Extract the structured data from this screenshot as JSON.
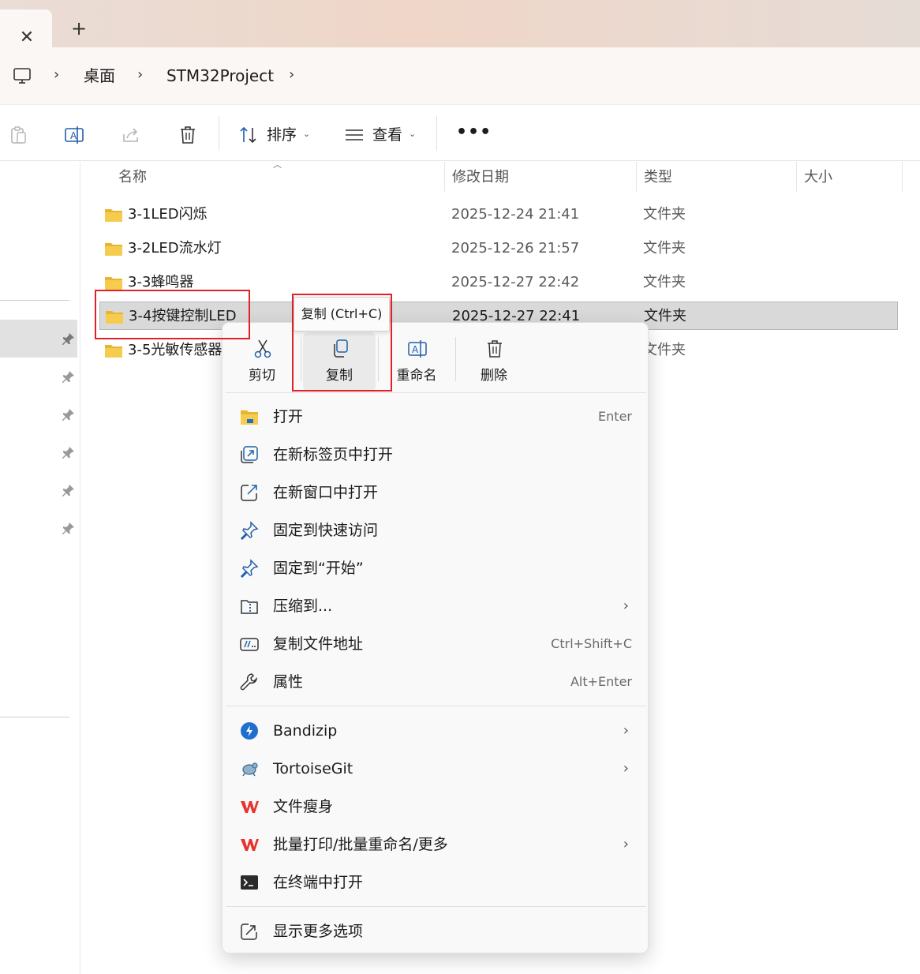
{
  "window": {
    "tab_close": "✕",
    "tab_new": "+"
  },
  "breadcrumb": {
    "items": [
      "桌面",
      "STM32Project"
    ],
    "separator": "›"
  },
  "toolbar": {
    "sort_label": "排序",
    "view_label": "查看",
    "more_label": "•••",
    "caret": "⌄"
  },
  "columns": {
    "name": "名称",
    "date": "修改日期",
    "type": "类型",
    "size": "大小"
  },
  "files": [
    {
      "name": "3-1LED闪烁",
      "date": "2025-12-24 21:41",
      "type": "文件夹"
    },
    {
      "name": "3-2LED流水灯",
      "date": "2025-12-26 21:57",
      "type": "文件夹"
    },
    {
      "name": "3-3蜂鸣器",
      "date": "2025-12-27 22:42",
      "type": "文件夹"
    },
    {
      "name": "3-4按键控制LED",
      "date": "2025-12-27 22:41",
      "type": "文件夹"
    },
    {
      "name": "3-5光敏传感器",
      "date": "",
      "type": "文件夹"
    }
  ],
  "tooltip": "复制 (Ctrl+C)",
  "context_menu": {
    "quick_actions": [
      "剪切",
      "复制",
      "重命名",
      "删除"
    ],
    "items": [
      {
        "label": "打开",
        "shortcut": "Enter"
      },
      {
        "label": "在新标签页中打开"
      },
      {
        "label": "在新窗口中打开"
      },
      {
        "label": "固定到快速访问"
      },
      {
        "label": "固定到“开始”"
      },
      {
        "label": "压缩到...",
        "arrow": "›"
      },
      {
        "label": "复制文件地址",
        "shortcut": "Ctrl+Shift+C"
      },
      {
        "label": "属性",
        "shortcut": "Alt+Enter"
      },
      {
        "label": "Bandizip",
        "arrow": "›"
      },
      {
        "label": "TortoiseGit",
        "arrow": "›"
      },
      {
        "label": "文件瘦身"
      },
      {
        "label": "批量打印/批量重命名/更多",
        "arrow": "›"
      },
      {
        "label": "在终端中打开"
      },
      {
        "label": "显示更多选项"
      }
    ]
  },
  "colors": {
    "annotation_red": "#e0202a",
    "accent_blue": "#0067c0",
    "folder_yellow": "#f3c545",
    "wps_red": "#e8322b"
  }
}
